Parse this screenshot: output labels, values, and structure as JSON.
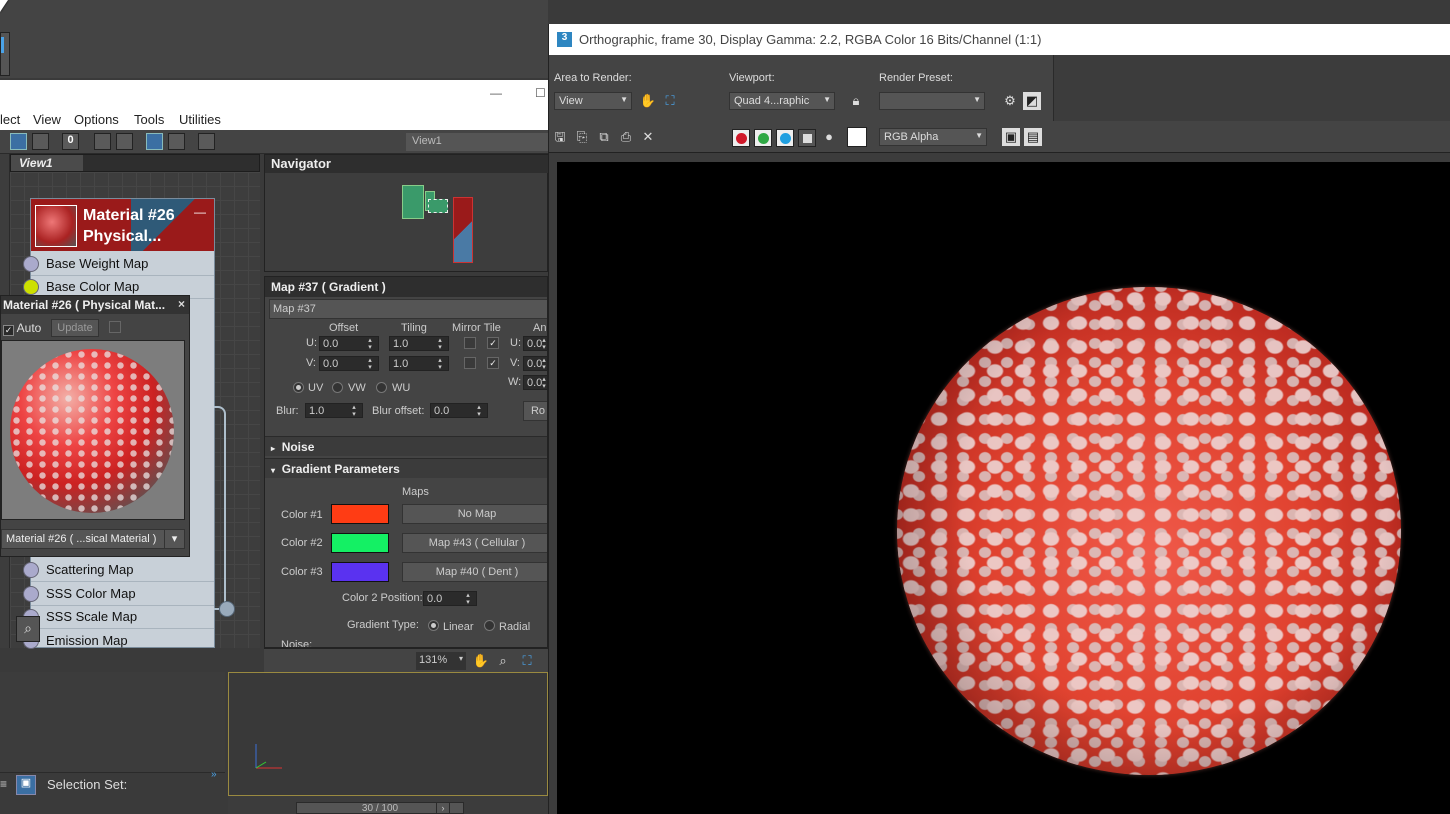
{
  "sme": {
    "menu": [
      "lect",
      "View",
      "Options",
      "Tools",
      "Utilities"
    ],
    "view_dropdown": "View1",
    "view_tab": "View1",
    "node": {
      "title_line1": "Material #26",
      "title_line2": "Physical...",
      "slots": [
        {
          "label": "Base Weight Map"
        },
        {
          "label": "Base Color Map"
        },
        {
          "label": "Scattering Map"
        },
        {
          "label": "SSS Color Map"
        },
        {
          "label": "SSS Scale Map"
        },
        {
          "label": "Emission Map"
        }
      ]
    },
    "preview": {
      "title": "Material #26  ( Physical Mat...",
      "auto_label": "Auto",
      "update_label": "Update",
      "selector": "Material #26  ( ...sical Material )"
    },
    "navigator_title": "Navigator",
    "params": {
      "title": "Map #37  ( Gradient )",
      "map_name": "Map #37",
      "col_offset": "Offset",
      "col_tiling": "Tiling",
      "col_mirror_tile": "Mirror Tile",
      "col_angle": "An",
      "u_label": "U:",
      "v_label": "V:",
      "w_label": "W:",
      "u_offset": "0.0",
      "v_offset": "0.0",
      "u_tiling": "1.0",
      "v_tiling": "1.0",
      "u_angle": "0.0",
      "v_angle": "0.0",
      "w_angle": "0.0",
      "uv": "UV",
      "vw": "VW",
      "wu": "WU",
      "blur_label": "Blur:",
      "blur": "1.0",
      "blur_offset_label": "Blur offset:",
      "blur_offset": "0.0",
      "rotate_btn": "Ro",
      "noise_rollout": "Noise",
      "gradient_rollout": "Gradient Parameters",
      "maps_label": "Maps",
      "colors": [
        {
          "label": "Color #1",
          "color": "#ff3c14",
          "map": "No Map"
        },
        {
          "label": "Color #2",
          "color": "#14f064",
          "map": "Map #43  ( Cellular )"
        },
        {
          "label": "Color #3",
          "color": "#5a32f0",
          "map": "Map #40  ( Dent )"
        }
      ],
      "color2_pos_label": "Color 2 Position:",
      "color2_pos": "0.0",
      "gradient_type_label": "Gradient Type:",
      "linear": "Linear",
      "radial": "Radial",
      "noise_label": "Noise:"
    },
    "zoom": "131%",
    "selection_set": "Selection Set:",
    "time_slider": "30 / 100"
  },
  "frame_window": {
    "title": "Orthographic, frame 30, Display Gamma: 2.2, RGBA Color 16 Bits/Channel (1:1)",
    "area_to_render_label": "Area to Render:",
    "area_to_render": "View",
    "viewport_label": "Viewport:",
    "viewport": "Quad 4...raphic",
    "render_preset_label": "Render Preset:",
    "render_preset": "",
    "channel": "RGB Alpha"
  }
}
